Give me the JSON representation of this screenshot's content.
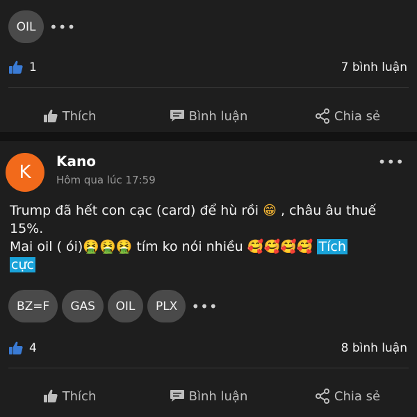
{
  "top_card": {
    "tags": [
      "OIL"
    ],
    "likes": "1",
    "comments": "7 bình luận"
  },
  "actions": {
    "like": "Thích",
    "comment": "Bình luận",
    "share": "Chia sẻ"
  },
  "post": {
    "avatar_letter": "K",
    "author": "Kano",
    "time": "Hôm qua lúc 17:59",
    "line1": "Trump đã hết con cạc (card) để hù rồi",
    "grin_emoji": "😁",
    "line1_end": ", châu âu thuế",
    "line2": "15%.",
    "line3": "Mai oil ( ói)",
    "vomit_emoji": "🤮🤮🤮",
    "line3_mid": "tím ko nói nhiều",
    "hug_emoji": "🥰🥰🥰🥰",
    "highlight_part1": "Tích",
    "highlight_part2": "cực",
    "tags": [
      "BZ=F",
      "GAS",
      "OIL",
      "PLX"
    ],
    "likes": "4",
    "comments": "8 bình luận"
  },
  "colors": {
    "background": "#121212",
    "card": "#1e1e1e",
    "tag": "#4a4a4a",
    "avatar": "#f26a1b",
    "like_blue": "#3a7bd5",
    "highlight": "#1aa3d9"
  },
  "icons": [
    "more-dots-icon",
    "like-thumb-icon",
    "thumb-up-outline-icon",
    "comment-bubble-icon",
    "share-icon"
  ]
}
